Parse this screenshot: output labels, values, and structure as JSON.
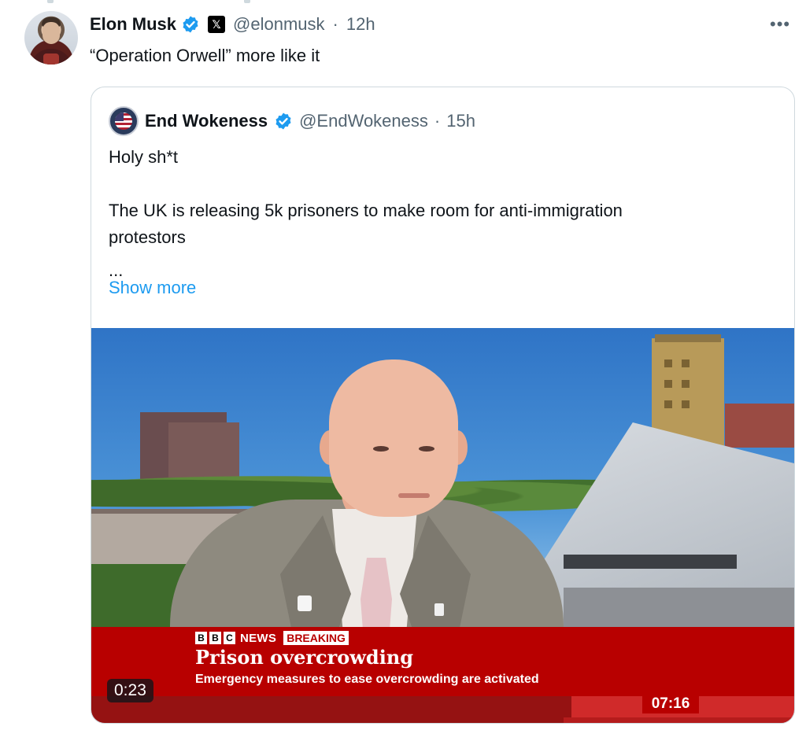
{
  "tweet": {
    "author_name": "Elon Musk",
    "handle": "@elonmusk",
    "time": "12h",
    "separator": "·",
    "text": "“Operation Orwell” more like it",
    "more_icon": "more-horizontal-icon",
    "affiliate_badge": "𝕏"
  },
  "quote": {
    "author_name": "End Wokeness",
    "handle": "@EndWokeness",
    "time": "15h",
    "separator": "·",
    "line1": "Holy sh*t",
    "line2": "The UK is releasing 5k prisoners to make room for anti-immigration",
    "line3": "protestors",
    "ellipsis": "...",
    "show_more": "Show more"
  },
  "video": {
    "elapsed": "0:23",
    "clock": "07:16",
    "bbc_letters": [
      "B",
      "B",
      "C"
    ],
    "news_label": "NEWS",
    "breaking_label": "BREAKING",
    "headline": "Prison overcrowding",
    "subline": "Emergency measures to ease overcrowding are activated"
  },
  "colors": {
    "link": "#1d9bf0",
    "verified": "#1d9bf0",
    "bbc_red": "#b80000",
    "meta_text": "#536471"
  }
}
